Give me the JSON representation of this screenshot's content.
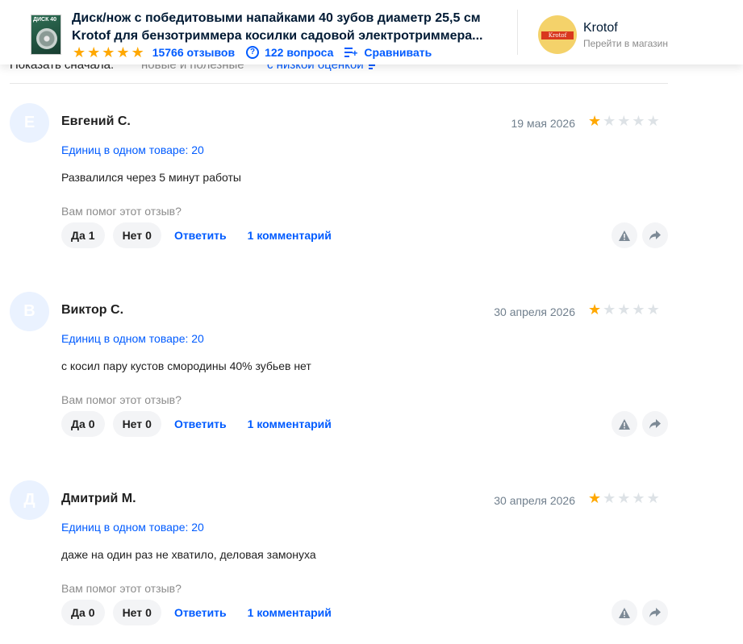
{
  "product": {
    "title_line1": "Диск/нож с победитовыми напайками 40 зубов диаметр 25,5 см",
    "title_line2": "Krotof для бензотриммера косилки садовой электротриммера...",
    "thumb_text": "ДИСК 40",
    "rating_stars": 5,
    "reviews_label": "15766 отзывов",
    "questions_label": "122 вопроса",
    "compare_label": "Сравнивать"
  },
  "shop": {
    "logo_text": "Krotof",
    "name": "Krotof",
    "link": "Перейти в магазин"
  },
  "sort": {
    "label": "Показать сначала:",
    "option_new": "новые и полезные",
    "option_low": "с низкой оценкой"
  },
  "reviews": [
    {
      "avatar": "Е",
      "name": "Евгений С.",
      "date": "19 мая 2026",
      "rating": 1,
      "units": "Единиц в одном товаре: 20",
      "text": "Развалился через 5 минут работы",
      "helpful_prompt": "Вам помог этот отзыв?",
      "yes_label": "Да",
      "yes_count": "1",
      "no_label": "Нет",
      "no_count": "0",
      "reply": "Ответить",
      "comments": "1 комментарий"
    },
    {
      "avatar": "В",
      "name": "Виктор С.",
      "date": "30 апреля 2026",
      "rating": 1,
      "units": "Единиц в одном товаре: 20",
      "text": "с косил пару кустов смородины 40% зубьев нет",
      "helpful_prompt": "Вам помог этот отзыв?",
      "yes_label": "Да",
      "yes_count": "0",
      "no_label": "Нет",
      "no_count": "0",
      "reply": "Ответить",
      "comments": "1 комментарий"
    },
    {
      "avatar": "Д",
      "name": "Дмитрий М.",
      "date": "30 апреля 2026",
      "rating": 1,
      "units": "Единиц в одном товаре: 20",
      "text": "даже на один раз не хватило, деловая замонуха",
      "helpful_prompt": "Вам помог этот отзыв?",
      "yes_label": "Да",
      "yes_count": "0",
      "no_label": "Нет",
      "no_count": "0",
      "reply": "Ответить",
      "comments": "1 комментарий"
    }
  ],
  "colors": {
    "accent": "#005bff",
    "star": "#ffa800",
    "star_off": "#dde2e6"
  }
}
